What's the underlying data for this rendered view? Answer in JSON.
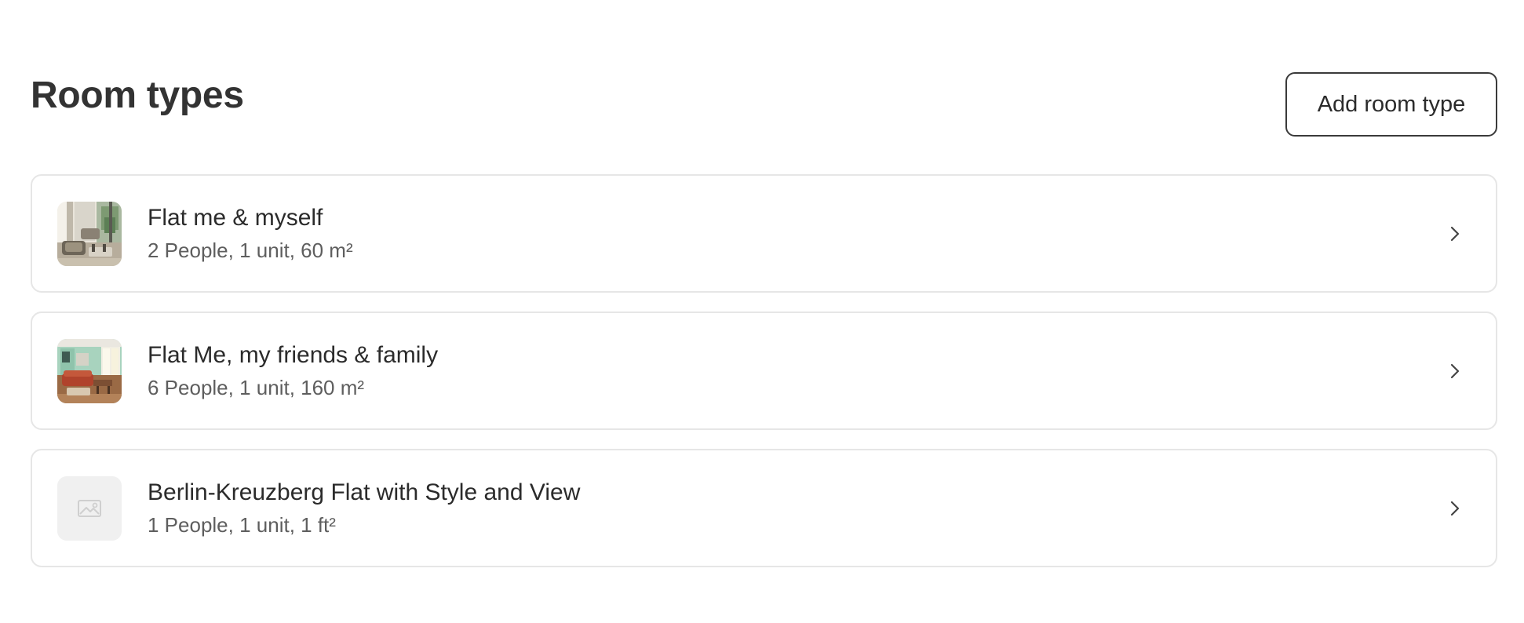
{
  "header": {
    "title": "Room types",
    "add_button_label": "Add room type"
  },
  "room_types": [
    {
      "name": "Flat me & myself",
      "details": "2 People, 1 unit, 60 m²",
      "thumbnail": "photo"
    },
    {
      "name": "Flat Me, my friends & family",
      "details": "6 People, 1 unit, 160 m²",
      "thumbnail": "photo"
    },
    {
      "name": "Berlin-Kreuzberg Flat with Style and View",
      "details": "1 People, 1 unit, 1 ft²",
      "thumbnail": "image-placeholder-icon"
    }
  ],
  "icons": {
    "row_action": "chevron-right-icon"
  },
  "colors": {
    "card_border": "#e6e6e6",
    "button_border": "#3a3a3a",
    "text_primary": "#2b2b2b",
    "text_secondary": "#5e5e5e",
    "placeholder_bg": "#f0f0f0"
  }
}
